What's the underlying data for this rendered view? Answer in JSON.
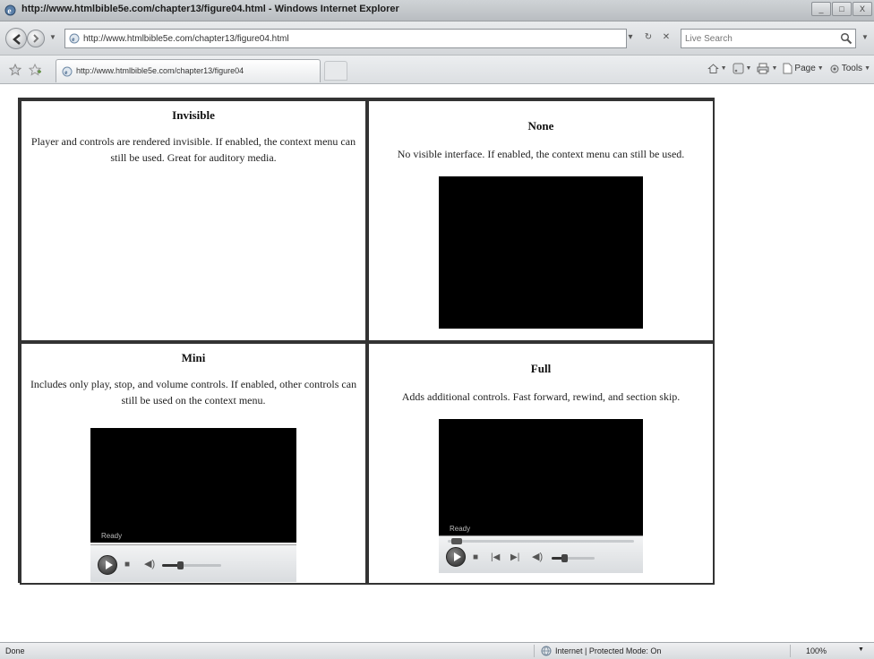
{
  "window": {
    "title": "http://www.htmlbible5e.com/chapter13/figure04.html - Windows Internet Explorer",
    "buttons": [
      "_",
      "□",
      "X"
    ]
  },
  "nav": {
    "address": "http://www.htmlbible5e.com/chapter13/figure04.html",
    "search_placeholder": "Live Search"
  },
  "tab": {
    "title": "http://www.htmlbible5e.com/chapter13/figure04"
  },
  "command_bar": {
    "page_label": "Page",
    "tools_label": "Tools"
  },
  "cells": {
    "invisible": {
      "title": "Invisible",
      "description": "Player and controls are rendered invisible. If enabled, the context menu can still be used. Great for auditory media."
    },
    "none": {
      "title": "None",
      "description": "No visible interface. If enabled, the context menu can still be used."
    },
    "mini": {
      "title": "Mini",
      "description": "Includes only play, stop, and volume controls. If enabled, other controls can still be used on the context menu.",
      "status": "Ready",
      "volume_level": 0.3
    },
    "full": {
      "title": "Full",
      "description": "Adds additional controls. Fast forward, rewind, and section skip.",
      "status": "Ready",
      "volume_level": 0.3
    }
  },
  "status_bar": {
    "status": "Done",
    "zone": "Internet | Protected Mode: On",
    "zoom": "100%"
  }
}
